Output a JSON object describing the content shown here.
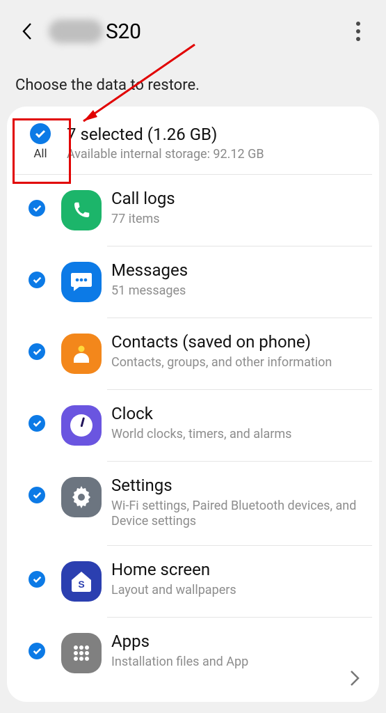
{
  "header": {
    "device_name": "S20"
  },
  "instruction": "Choose the data to restore.",
  "select_all": {
    "label": "All",
    "summary": "7 selected (1.26 GB)",
    "storage": "Available internal storage: 92.12 GB"
  },
  "items": [
    {
      "icon": "phone-icon",
      "color": "#1cb56a",
      "title": "Call logs",
      "sub": "77 items"
    },
    {
      "icon": "message-icon",
      "color": "#0c7ae6",
      "title": "Messages",
      "sub": "51 messages"
    },
    {
      "icon": "contact-icon",
      "color": "#f3871b",
      "title": "Contacts (saved on phone)",
      "sub": "Contacts, groups, and other information"
    },
    {
      "icon": "clock-icon",
      "color": "#6a55e0",
      "title": "Clock",
      "sub": "World clocks, timers, and alarms"
    },
    {
      "icon": "gear-icon",
      "color": "#6c7580",
      "title": "Settings",
      "sub": "Wi-Fi settings, Paired Bluetooth devices, and Device settings"
    },
    {
      "icon": "home-icon",
      "color": "#2b3fb0",
      "title": "Home screen",
      "sub": "Layout and wallpapers"
    },
    {
      "icon": "apps-icon",
      "color": "#808080",
      "title": "Apps",
      "sub": "Installation files and App"
    }
  ]
}
